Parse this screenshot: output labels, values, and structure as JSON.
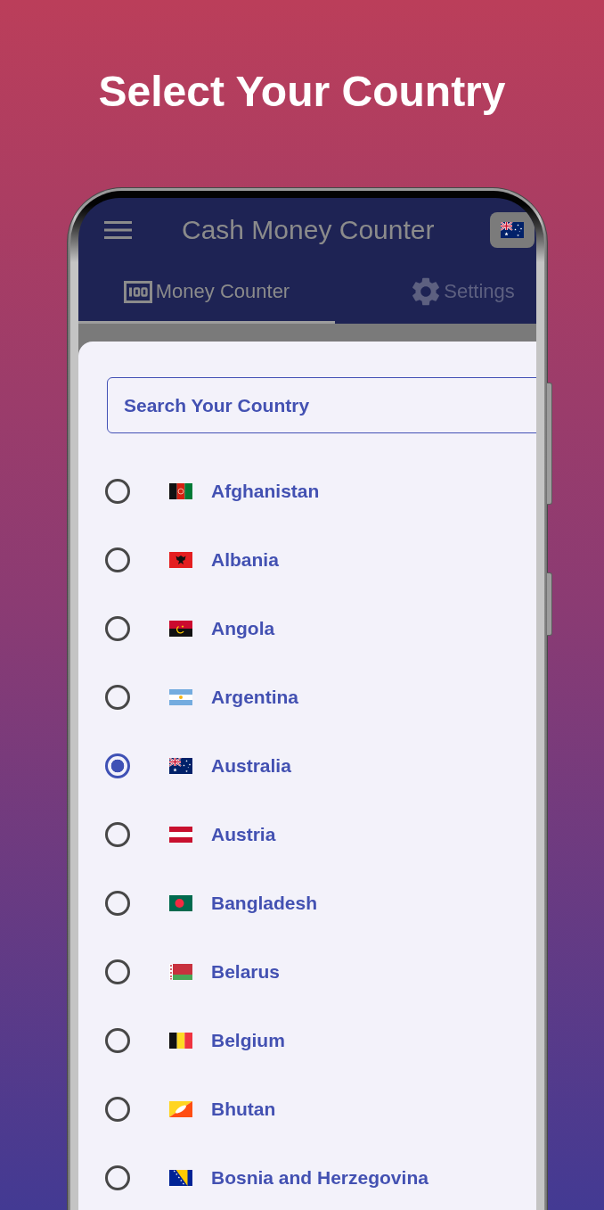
{
  "headline": "Select Your Country",
  "app_bar": {
    "title": "Cash Money Counter"
  },
  "tabs": [
    {
      "label": "Money Counter",
      "selected": true
    },
    {
      "label": "Settings",
      "selected": false
    }
  ],
  "country_picker": {
    "search": {
      "placeholder": "Search Your Country"
    },
    "countries": [
      {
        "name": "Afghanistan",
        "selected": false
      },
      {
        "name": "Albania",
        "selected": false
      },
      {
        "name": "Angola",
        "selected": false
      },
      {
        "name": "Argentina",
        "selected": false
      },
      {
        "name": "Australia",
        "selected": true
      },
      {
        "name": "Austria",
        "selected": false
      },
      {
        "name": "Bangladesh",
        "selected": false
      },
      {
        "name": "Belarus",
        "selected": false
      },
      {
        "name": "Belgium",
        "selected": false
      },
      {
        "name": "Bhutan",
        "selected": false
      },
      {
        "name": "Bosnia and Herzegovina",
        "selected": false
      }
    ]
  }
}
